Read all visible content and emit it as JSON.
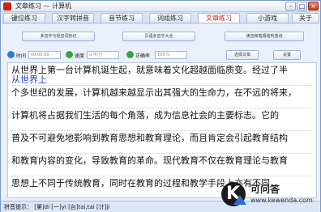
{
  "window": {
    "title": "文章练习 — 计算机",
    "controls": [
      "–",
      "□",
      "×"
    ]
  },
  "tabs": [
    {
      "label": "键位练习",
      "active": false
    },
    {
      "label": "汉字转拼音",
      "active": false
    },
    {
      "label": "音节练习",
      "active": false
    },
    {
      "label": "词组练习",
      "active": false
    },
    {
      "label": "文章练习",
      "active": true
    },
    {
      "label": "小游戏",
      "active": false
    },
    {
      "label": "关于",
      "active": false
    }
  ],
  "buttons": {
    "left": "多音字与轻音词标记",
    "middle": "贝语多音字大全",
    "right": "读音和笔顺结构查询"
  },
  "status": {
    "time_label": "时间",
    "time_value": "00:00:00",
    "speed_label": "速度",
    "speed_value": "0 字/分",
    "accuracy_label": "正确率",
    "accuracy_value": "100 %",
    "choose_button": "选择文章",
    "settings_button": "设置"
  },
  "article": {
    "typed_line": "从世界上",
    "lines": [
      "从世界上第一台计算机诞生起，就意味着文化超越面临质变。经过了半",
      "个多世纪的发展，计算机越来越显示出其强大的生命力，在不远的将来，",
      "计算机将占据我们生活的每个角落，成为信息社会的主要标志。它的",
      "普及不可避免地影响到教育思想和教育理论，而且肯定会引起教育结构",
      "和教育内容的变化，导致教育的革命。现代教育不仅在教育理论与教育",
      "思想上不同于传统教育，同时在教育的过程和教学手段上亦有不同"
    ]
  },
  "hint": {
    "text": "拼音提示： [第]di  [一]yi  [台]tai,tai  [计]ji"
  },
  "watermark": {
    "brand": "可问答",
    "url": "www.kewenda.com"
  },
  "colors": {
    "active_tab_text": "#c0201a",
    "typed_text": "#2a40d0",
    "time_icon": "#2e7bd6",
    "speed_icon": "#3aa53a",
    "accuracy_icon": "#3aa53a"
  }
}
